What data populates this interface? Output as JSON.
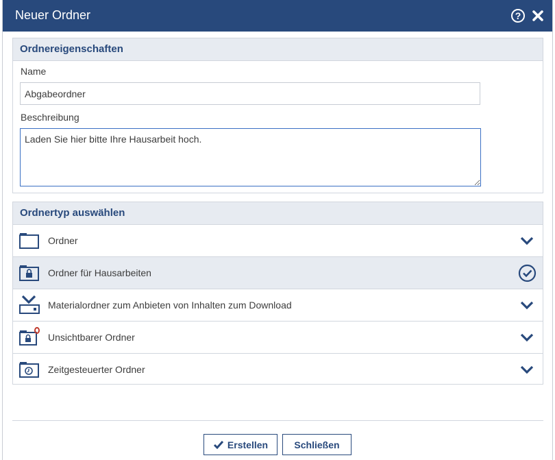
{
  "dialog": {
    "title": "Neuer Ordner",
    "help_symbol": "?",
    "colors": {
      "header": "#28497c",
      "section": "#e7ebf1",
      "accent": "#28497c",
      "alert": "#c0392b"
    }
  },
  "properties": {
    "heading": "Ordnereigenschaften",
    "name_label": "Name",
    "name_value": "Abgabeordner",
    "description_label": "Beschreibung",
    "description_value": "Laden Sie hier bitte Ihre Hausarbeit hoch."
  },
  "folder_types": {
    "heading": "Ordnertyp auswählen",
    "items": [
      {
        "label": "Ordner",
        "icon": "folder-icon",
        "state": "collapsed"
      },
      {
        "label": "Ordner für Hausarbeiten",
        "icon": "locked-folder-icon",
        "state": "selected"
      },
      {
        "label": "Materialordner zum Anbieten von Inhalten zum Download",
        "icon": "download-folder-icon",
        "state": "collapsed"
      },
      {
        "label": "Unsichtbarer Ordner",
        "icon": "invisible-folder-icon",
        "state": "collapsed"
      },
      {
        "label": "Zeitgesteuerter Ordner",
        "icon": "timed-folder-icon",
        "state": "collapsed"
      }
    ]
  },
  "buttons": {
    "create": "Erstellen",
    "close": "Schließen"
  }
}
